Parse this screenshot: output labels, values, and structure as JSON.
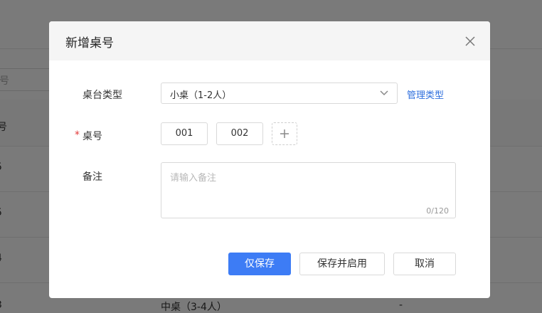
{
  "background": {
    "search_placeholder": "号",
    "header_fragment": "号",
    "row_fragments": [
      "5",
      "5",
      "4",
      "3"
    ],
    "last_row_type": "中桌（3-4人）",
    "last_row_dash": "-"
  },
  "dialog": {
    "title": "新增桌号",
    "close_icon": "close-icon",
    "fields": {
      "table_type_label": "桌台类型",
      "table_type_value": "小桌（1-2人）",
      "manage_types_link": "管理类型",
      "table_number_label": "桌号",
      "required_mark": "*",
      "table_numbers": [
        "001",
        "002"
      ],
      "remark_label": "备注",
      "remark_placeholder": "请输入备注",
      "remark_counter": "0/120"
    },
    "buttons": {
      "save_only": "仅保存",
      "save_and_enable": "保存并启用",
      "cancel": "取消"
    }
  },
  "colors": {
    "primary": "#3d7cf5",
    "link": "#2f6fdd",
    "required": "#e33a3a"
  }
}
